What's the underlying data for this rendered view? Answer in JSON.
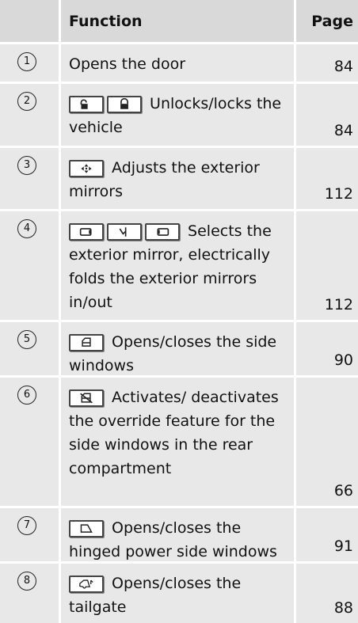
{
  "header": {
    "function": "Function",
    "page": "Page"
  },
  "rows": [
    {
      "num": "1",
      "text": "Opens the door",
      "page": "84",
      "icons": []
    },
    {
      "num": "2",
      "text": "Unlocks/locks the vehicle",
      "page": "84",
      "icons": [
        "unlock-icon",
        "lock-icon"
      ]
    },
    {
      "num": "3",
      "text": "Adjusts the exterior mirrors",
      "page": "112",
      "icons": [
        "mirror-adjust-icon"
      ]
    },
    {
      "num": "4",
      "text": "Selects the exterior mirror, electrically folds the exterior mirrors in/out",
      "page": "112",
      "icons": [
        "left-mirror-icon",
        "mirror-fold-icon",
        "right-mirror-icon"
      ]
    },
    {
      "num": "5",
      "text": "Opens/closes the side windows",
      "page": "90",
      "icons": [
        "side-window-icon"
      ]
    },
    {
      "num": "6",
      "text": "Activates/ deactivates the override feature for the side windows in the rear compartment",
      "page": "66",
      "icons": [
        "window-override-icon"
      ]
    },
    {
      "num": "7",
      "text": "Opens/closes the hinged power side windows",
      "page": "91",
      "icons": [
        "hinged-window-icon"
      ]
    },
    {
      "num": "8",
      "text": "Opens/closes the tailgate",
      "page": "88",
      "icons": [
        "tailgate-icon"
      ]
    }
  ]
}
